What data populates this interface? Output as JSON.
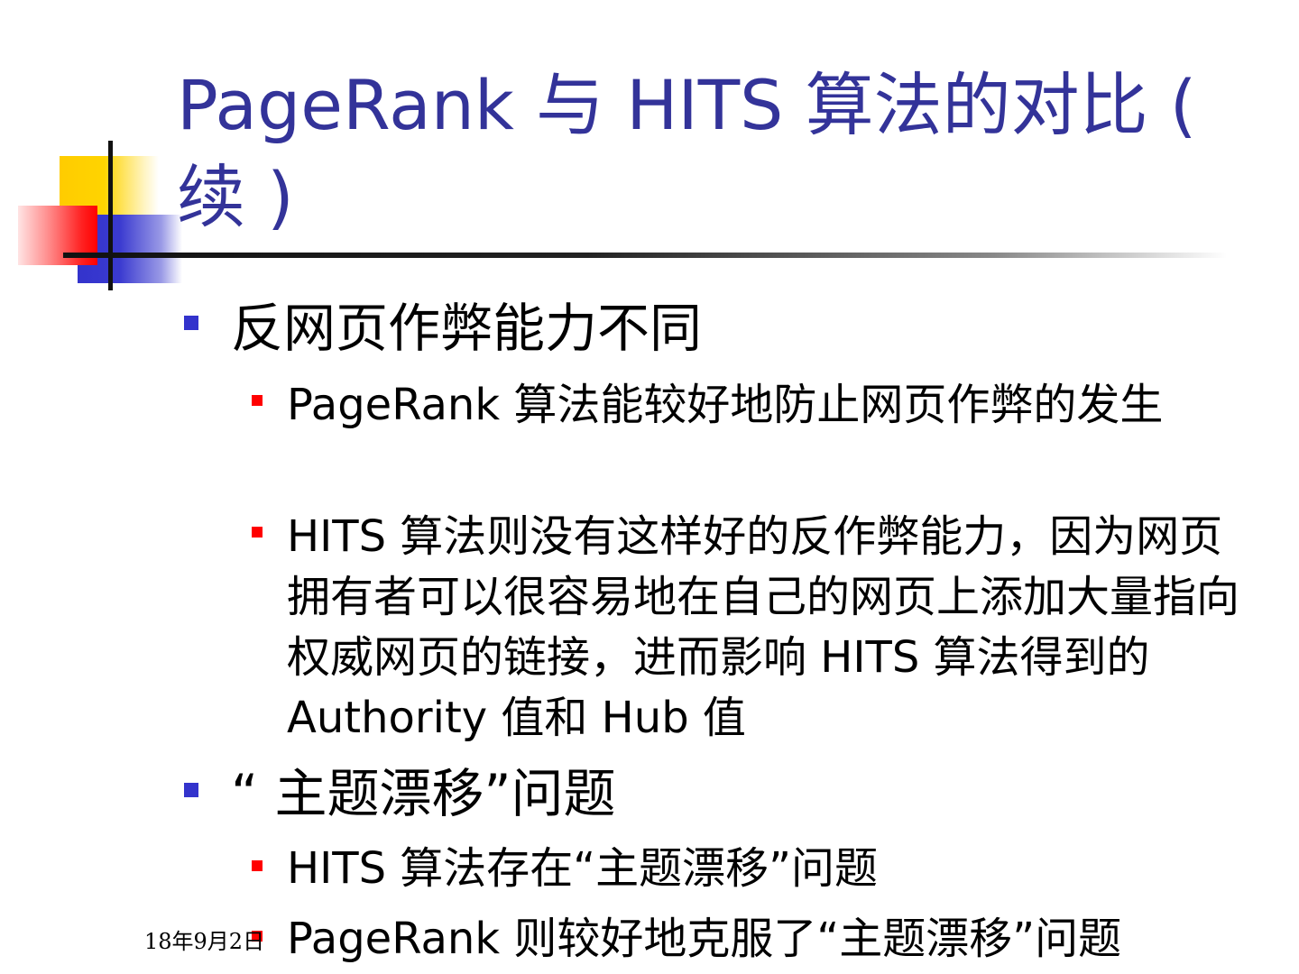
{
  "slide": {
    "title": "PageRank 与 HITS 算法的对比 ( 续 )",
    "bullets": [
      {
        "level": 1,
        "text": "反网页作弊能力不同"
      },
      {
        "level": 2,
        "text": "PageRank 算法能较好地防止网页作弊的发生"
      },
      {
        "level": 2,
        "text": "HITS 算法则没有这样好的反作弊能力，因为网页拥有者可以很容易地在自己的网页上添加大量指向权威网页的链接，进而影响 HITS 算法得到的 Authority 值和 Hub 值"
      },
      {
        "level": 1,
        "text": "“ 主题漂移”问题"
      },
      {
        "level": 2,
        "text": "HITS 算法存在“主题漂移”问题"
      },
      {
        "level": 2,
        "text": "PageRank 则较好地克服了“主题漂移”问题"
      }
    ],
    "footer_date": "18年9月2日"
  },
  "colors": {
    "title": "#333399",
    "bullet_level1": "#3333cc",
    "bullet_level2": "#ff0000",
    "deco_yellow": "#ffcc00",
    "deco_blue": "#3333cc",
    "deco_red": "#ff0000"
  }
}
